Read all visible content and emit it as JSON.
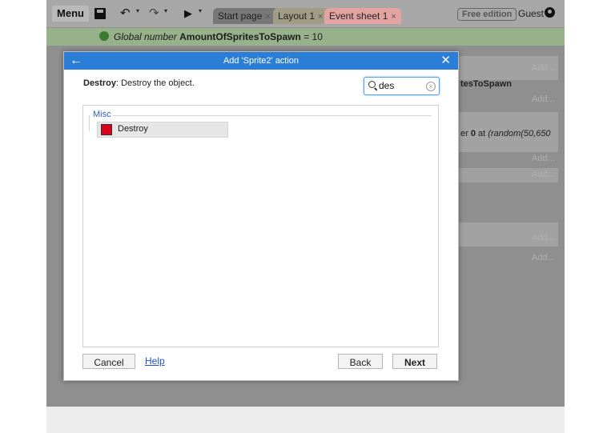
{
  "toolbar": {
    "menu_label": "Menu",
    "tabs": [
      {
        "label": "Start page",
        "close": "×"
      },
      {
        "label": "Layout 1",
        "close": "×"
      },
      {
        "label": "Event sheet 1",
        "close": "×"
      }
    ],
    "edition_label": "Free edition",
    "user_label": "Guest",
    "icons": [
      "save-icon",
      "undo-icon",
      "redo-icon",
      "play-icon",
      "user-icon"
    ]
  },
  "global_row": {
    "prefix": "Global number",
    "name": "AmountOfSpritesToSpawn",
    "suffix": "= 10"
  },
  "background": {
    "frag_1": "tesToSpawn",
    "frag_2_pre": "er",
    "frag_2_num": "0",
    "frag_2_at": "at",
    "frag_2_fn": "(random(50,650",
    "add_label": "Add..."
  },
  "dialog": {
    "title": "Add 'Sprite2' action",
    "desc_name": "Destroy",
    "desc_text": ": Destroy the object.",
    "search_value": "des",
    "group_label": "Misc",
    "items": [
      {
        "label": "Destroy",
        "icon_color": "#d9001b"
      }
    ],
    "cancel_label": "Cancel",
    "help_label": "Help",
    "back_label": "Back",
    "next_label": "Next",
    "header_color": "#2b7ed8"
  }
}
